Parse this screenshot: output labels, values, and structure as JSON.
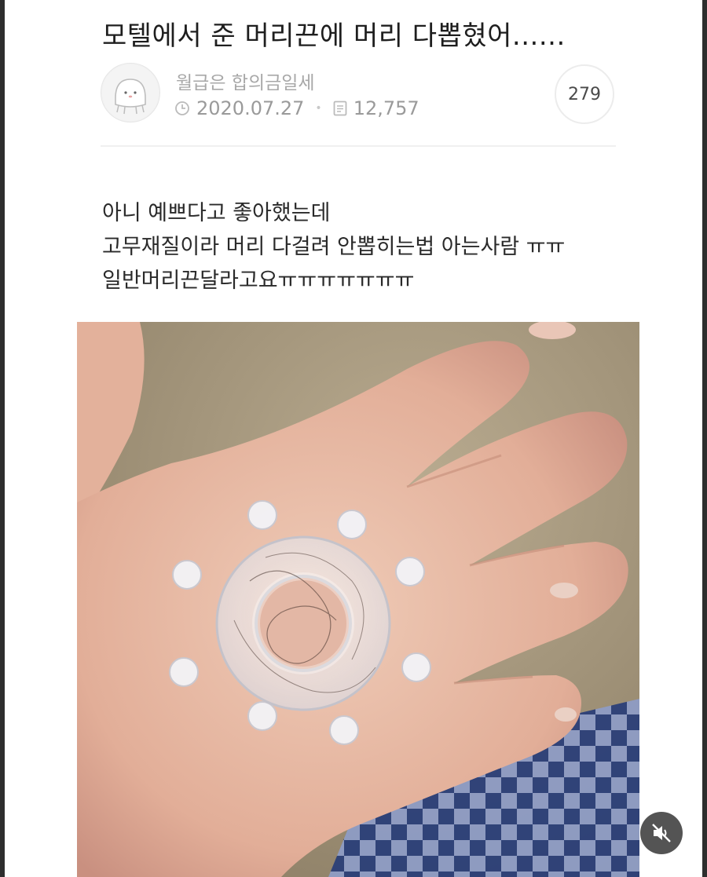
{
  "post": {
    "title": "모텔에서 준 머리끈에 머리 다뽑혔어......",
    "author": "월급은 합의금일세",
    "date": "2020.07.27",
    "views": "12,757",
    "comment_count": "279",
    "body_lines": [
      "아니 예쁘다고 좋아했는데",
      "고무재질이라 머리 다걸려 안뽑히는법 아는사람 ㅠㅠ",
      "일반머리끈달라고요ㅠㅠㅠㅠㅠㅠㅠ"
    ]
  },
  "icons": {
    "avatar": "cartoon-face-avatar",
    "date": "clock-icon",
    "views": "document-icon",
    "mute": "speaker-muted-icon"
  },
  "colors": {
    "title": "#1e1e1e",
    "meta": "#9a9a9a",
    "body": "#2a2a2a",
    "mute_bg": "#3c3c3c"
  }
}
